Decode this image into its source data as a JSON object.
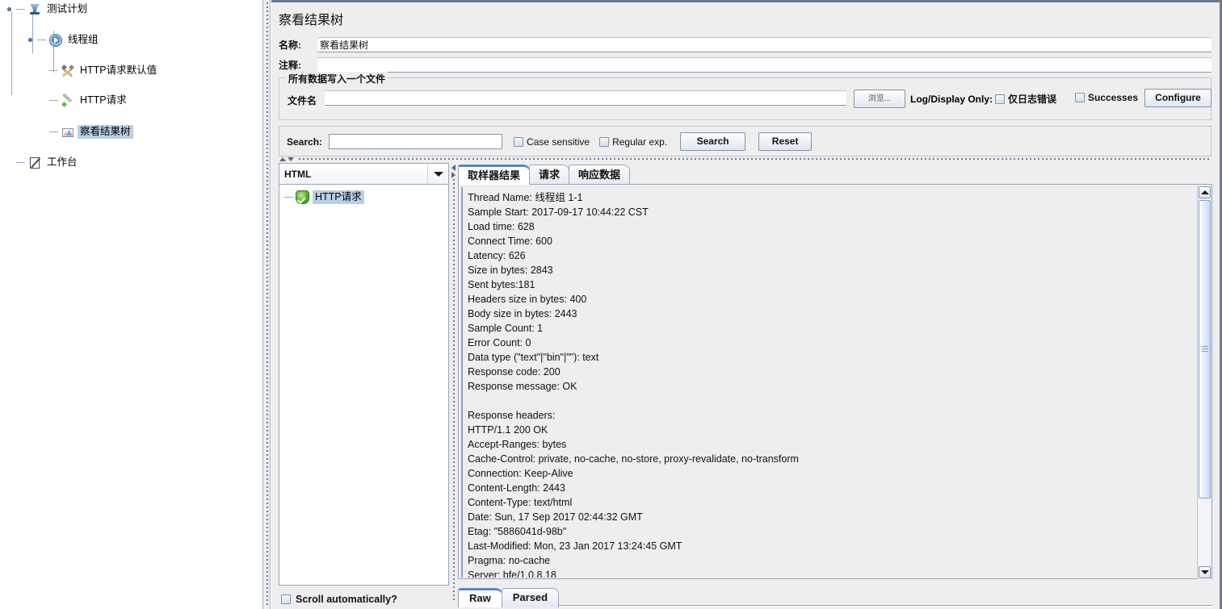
{
  "tree": {
    "items": [
      {
        "label": "测试计划",
        "icon": "test-plan-icon",
        "selected": false
      },
      {
        "label": "线程组",
        "icon": "thread-group-icon",
        "selected": false
      },
      {
        "label": "HTTP请求默认值",
        "icon": "http-defaults-icon",
        "selected": false
      },
      {
        "label": "HTTP请求",
        "icon": "http-request-icon",
        "selected": false
      },
      {
        "label": "察看结果树",
        "icon": "view-results-tree-icon",
        "selected": true
      },
      {
        "label": "工作台",
        "icon": "workbench-icon",
        "selected": false
      }
    ]
  },
  "main": {
    "title": "察看结果树",
    "name_label": "名称:",
    "name_value": "察看结果树",
    "comment_label": "注释:",
    "comment_value": "",
    "file_group": {
      "title": "所有数据写入一个文件",
      "filename_label": "文件名",
      "filename_value": "",
      "browse_label": "浏览...",
      "log_display_label": "Log/Display Only:",
      "errors_only_label": "仅日志错误",
      "errors_only_checked": false,
      "successes_label": "Successes",
      "successes_checked": false,
      "configure_label": "Configure"
    },
    "search": {
      "label": "Search:",
      "value": "",
      "case_sensitive_label": "Case sensitive",
      "case_sensitive_checked": false,
      "regular_exp_label": "Regular exp.",
      "regular_exp_checked": false,
      "search_button": "Search",
      "reset_button": "Reset"
    },
    "results_panel": {
      "renderer_selected": "HTML",
      "sample_label": "HTTP请求",
      "sample_status": "success",
      "scroll_auto_label": "Scroll automatically?",
      "scroll_auto_checked": false
    },
    "tabs": [
      {
        "label": "取样器结果",
        "active": true
      },
      {
        "label": "请求",
        "active": false
      },
      {
        "label": "响应数据",
        "active": false
      }
    ],
    "bottom_tabs": [
      {
        "label": "Raw",
        "active": true
      },
      {
        "label": "Parsed",
        "active": false
      }
    ],
    "sampler_result_lines": [
      "Thread Name: 线程组 1-1",
      "Sample Start: 2017-09-17 10:44:22 CST",
      "Load time: 628",
      "Connect Time: 600",
      "Latency: 626",
      "Size in bytes: 2843",
      "Sent bytes:181",
      "Headers size in bytes: 400",
      "Body size in bytes: 2443",
      "Sample Count: 1",
      "Error Count: 0",
      "Data type (\"text\"|\"bin\"|\"\"): text",
      "Response code: 200",
      "Response message: OK",
      "",
      "Response headers:",
      "HTTP/1.1 200 OK",
      "Accept-Ranges: bytes",
      "Cache-Control: private, no-cache, no-store, proxy-revalidate, no-transform",
      "Connection: Keep-Alive",
      "Content-Length: 2443",
      "Content-Type: text/html",
      "Date: Sun, 17 Sep 2017 02:44:32 GMT",
      "Etag: \"5886041d-98b\"",
      "Last-Modified: Mon, 23 Jan 2017 13:24:45 GMT",
      "Pragma: no-cache",
      "Server: bfe/1.0.8.18"
    ]
  },
  "colors": {
    "window_border": "#6b7a94",
    "panel_bg": "#eeeeee",
    "selection": "#b8cfe5",
    "tab_accent": "#5b86c4",
    "success": "#3f9b20"
  }
}
